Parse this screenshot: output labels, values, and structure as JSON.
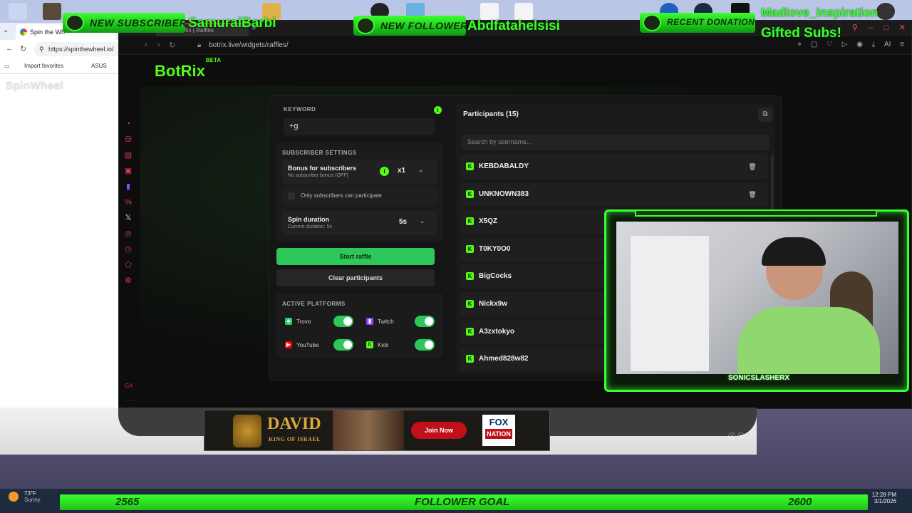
{
  "left_browser": {
    "tab_title": "Spin the Wh",
    "url": "https://spinthewheel.io/",
    "favorites": [
      "Import favorites",
      "ASUS"
    ],
    "site_logo": "SpinWheel"
  },
  "main_browser": {
    "tab_title": "BotRix | Raffles",
    "url": "botrix.live/widgets/raffles/"
  },
  "app": {
    "brand": "BotRix",
    "brand_badge": "BETA"
  },
  "raffle": {
    "keyword_label": "KEYWORD",
    "keyword_value": "+g",
    "subscriber_settings_label": "SUBSCRIBER SETTINGS",
    "bonus_title": "Bonus for subscribers",
    "bonus_subtitle": "No subscriber bonus (OFF)",
    "bonus_value": "x1",
    "only_subs_label": "Only subscribers can participate",
    "spin_title": "Spin duration",
    "spin_subtitle": "Current duration: 5s",
    "spin_value": "5s",
    "start_label": "Start raffle",
    "clear_label": "Clear participants",
    "platforms_label": "ACTIVE PLATFORMS",
    "platforms": [
      {
        "name": "Trovo",
        "enabled": true,
        "color": "#19d66b"
      },
      {
        "name": "Twitch",
        "enabled": true,
        "color": "#9146ff"
      },
      {
        "name": "YouTube",
        "enabled": true,
        "color": "#ff0000"
      },
      {
        "name": "Kick",
        "enabled": true,
        "color": "#53fc18"
      }
    ]
  },
  "participants": {
    "title": "Participants (15)",
    "search_placeholder": "Search by username...",
    "list": [
      "KEBDABALDY",
      "UNKNOWN383",
      "X5QZ",
      "T0KY0O0",
      "BigCocks",
      "Nickx9w",
      "A3zxtokyo",
      "Ahmed828w82"
    ]
  },
  "overlay": {
    "sub_badge": "NEW SUBSCRIBER",
    "sub_name": "SamuraiBarbi",
    "follower_badge": "NEW FOLLOWER",
    "follower_name": "Abdfatahelsisi",
    "donation_badge": "RECENT DONATION",
    "donation_name": "Madlove_inspiration",
    "donation_text": "Gifted Subs!",
    "cam_logo": "SONICSLASHERX"
  },
  "ad": {
    "title": "DAVID",
    "subtitle": "KING OF ISRAEL",
    "button": "Join Now",
    "brand_top": "FOX",
    "brand_bottom": "NATION"
  },
  "follower_goal": {
    "start": "2565",
    "label": "FOLLOWER GOAL",
    "end": "2600"
  },
  "taskbar": {
    "temp": "73°F",
    "weather": "Sunny",
    "time": "12:28 PM",
    "date": "3/1/2026"
  },
  "colors": {
    "kick_green": "#53fc18",
    "start_button": "#2ec75a",
    "accent_red": "#d4283a"
  }
}
